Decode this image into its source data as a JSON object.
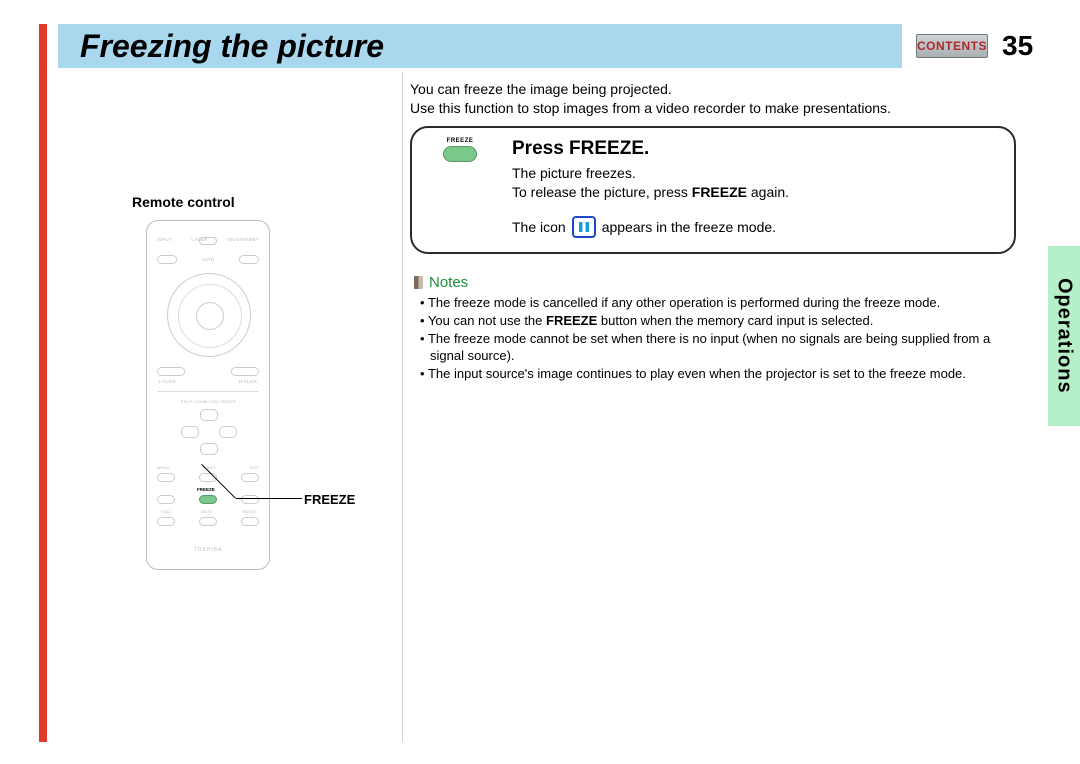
{
  "header": {
    "title": "Freezing the picture",
    "contents_button": "CONTENTS",
    "page_number": "35"
  },
  "side_tab": "Operations",
  "intro": {
    "line1": "You can freeze the image being projected.",
    "line2": "Use this function to stop images from a video recorder to make presentations."
  },
  "instruction": {
    "freeze_small_label": "FREEZE",
    "heading": "Press FREEZE.",
    "line1": "The picture freezes.",
    "line2a": "To release the picture, press ",
    "line2b": "FREEZE",
    "line2c": " again.",
    "icon_pre": "The icon ",
    "icon_post": " appears in the freeze mode."
  },
  "notes": {
    "title": "Notes",
    "items": [
      "The freeze mode is cancelled if any other operation is performed during the freeze mode.",
      "You can not use the FREEZE button when the memory card input is selected.",
      "The freeze mode cannot be set when there is no input (when no signals are being supplied from a signal source).",
      "The input source's image continues to play even when the projector is set to the freeze mode."
    ]
  },
  "remote": {
    "caption": "Remote control",
    "callout": "FREEZE",
    "labels": {
      "input": "INPUT",
      "onstandby": "ON/STANDBY",
      "laser": "LASER",
      "keystone": "KEYSTONE",
      "auto": "AUTO",
      "set": "SET",
      "lclick": "L-CLICK",
      "rclick": "R-CLICK",
      "pipzoom": "P IN P / ZOOM / VOL / ENTER",
      "menu": "MENU",
      "ratio": "RATIO",
      "exit": "EXIT",
      "freeze": "FREEZE",
      "call": "CALL",
      "mute": "MUTE",
      "resize": "RESIZE",
      "brand": "TOSHIBA"
    }
  }
}
